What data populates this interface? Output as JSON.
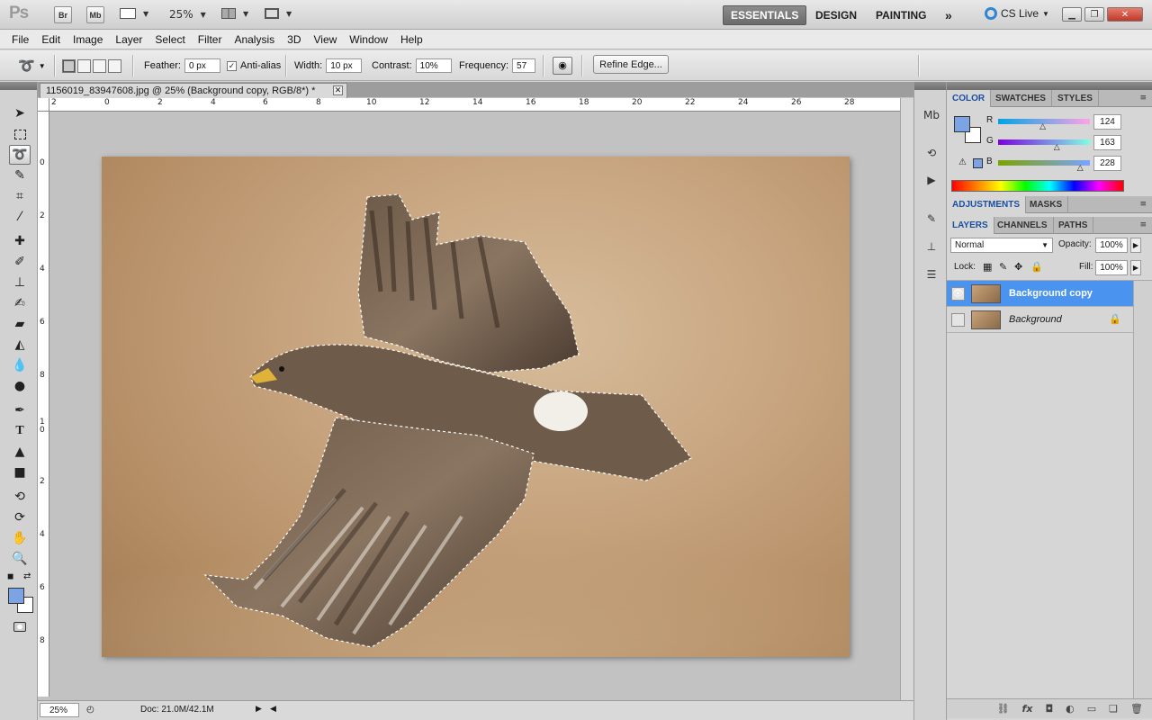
{
  "app": {
    "logo": "Ps",
    "bridge_label": "Br",
    "minibridge_label": "Mb",
    "zoom_value": "25%",
    "workspaces": [
      "ESSENTIALS",
      "DESIGN",
      "PAINTING"
    ],
    "more_glyph": "»",
    "cs_live": "CS Live"
  },
  "menu": [
    "File",
    "Edit",
    "Image",
    "Layer",
    "Select",
    "Filter",
    "Analysis",
    "3D",
    "View",
    "Window",
    "Help"
  ],
  "options": {
    "feather_label": "Feather:",
    "feather_value": "0 px",
    "antialias_label": "Anti-alias",
    "antialias_checked": true,
    "width_label": "Width:",
    "width_value": "10 px",
    "contrast_label": "Contrast:",
    "contrast_value": "10%",
    "frequency_label": "Frequency:",
    "frequency_value": "57",
    "refine_edge": "Refine Edge..."
  },
  "document": {
    "tab_title": "1156019_83947608.jpg @ 25% (Background copy, RGB/8*) *",
    "ruler_h": [
      "2",
      "0",
      "2",
      "4",
      "6",
      "8",
      "10",
      "12",
      "14",
      "16",
      "18",
      "20",
      "22",
      "24",
      "26",
      "28"
    ],
    "ruler_v": [
      "0",
      "2",
      "4",
      "6",
      "8",
      "1",
      "0",
      "2",
      "4",
      "6",
      "8"
    ],
    "status_zoom": "25%",
    "status_doc": "Doc: 21.0M/42.1M"
  },
  "color_panel": {
    "tabs": [
      "COLOR",
      "SWATCHES",
      "STYLES"
    ],
    "foreground": "#7ca3e4",
    "background": "#ffffff",
    "r_label": "R",
    "r_value": "124",
    "r_fraction": 0.486,
    "g_label": "G",
    "g_value": "163",
    "g_fraction": 0.639,
    "b_label": "B",
    "b_value": "228",
    "b_fraction": 0.894
  },
  "adjustments_panel": {
    "tabs": [
      "ADJUSTMENTS",
      "MASKS"
    ]
  },
  "layers_panel": {
    "tabs": [
      "LAYERS",
      "CHANNELS",
      "PATHS"
    ],
    "blend_mode": "Normal",
    "opacity_label": "Opacity:",
    "opacity_value": "100%",
    "lock_label": "Lock:",
    "fill_label": "Fill:",
    "fill_value": "100%",
    "layers": [
      {
        "name": "Background copy",
        "visible": true,
        "selected": true
      },
      {
        "name": "Background",
        "visible": false,
        "selected": false,
        "locked": true
      }
    ],
    "footer_icons": [
      "link-icon",
      "fx-icon",
      "mask-icon",
      "adjustment-icon",
      "group-icon",
      "new-layer-icon",
      "trash-icon"
    ]
  },
  "colors": {
    "accent_blue": "#4a94f0",
    "selected_tab_text": "#1a4fa0"
  }
}
